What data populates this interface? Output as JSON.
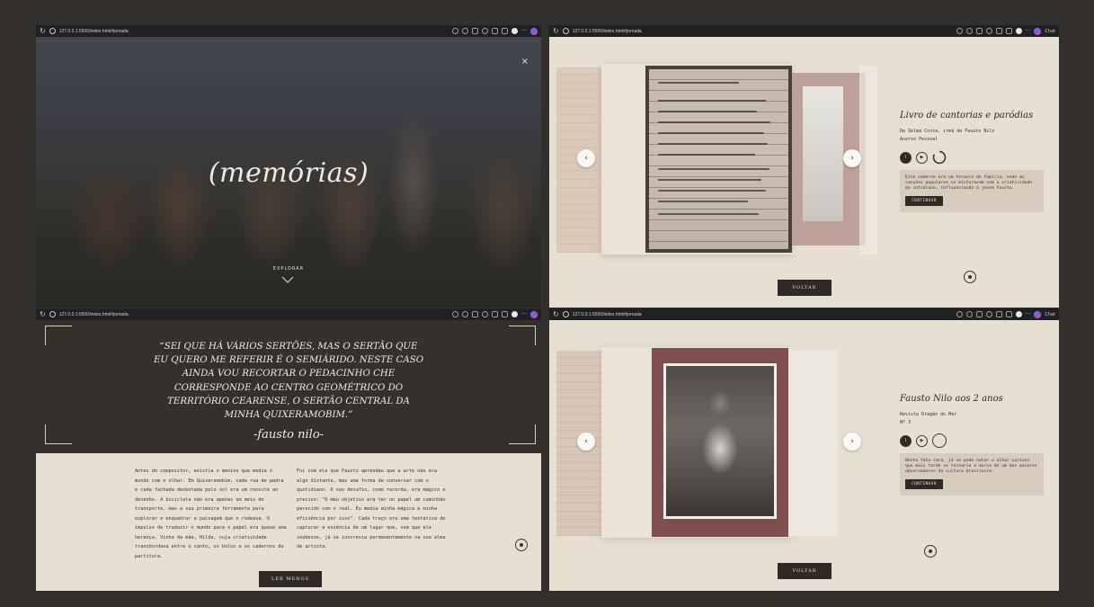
{
  "browser": {
    "url": "127.0.0.1:5500/index.html#jornada",
    "copilot_label": "Chat"
  },
  "hero": {
    "title": "(memórias)",
    "close": "×",
    "explore_label": "EXPLORAR"
  },
  "quote": {
    "text": "“SEI QUE HÁ VÁRIOS SERTÕES, MAS O SERTÃO QUE EU QUERO ME REFERIR É O SEMIÁRIDO. NESTE CASO AINDA VOU RECORTAR O PEDACINHO CHE CORRESPONDE AO CENTRO GEOMÉTRICO DO TERRITÓRIO CEARENSE, O SERTÃO CENTRAL DA MINHA QUIXERAMOBIM.”",
    "author": "-fausto nilo-"
  },
  "story": {
    "col_a": "Antes do compositor, existia o menino que media o mundo com o olhar. Em Quixeramobim, cada rua de pedra e cada fachada desbotada pelo sol era um convite ao desenho. A bicicleta não era apenas um meio de transporte, mas a sua primeira ferramenta para explorar e enquadrar a paisagem que o rodeava. O impulso de traduzir o mundo para o papel era quase uma herança. Vinha da mãe, Hilda, cuja criatividade transbordava entre o canto, os bolos e os cadernos de partitura.",
    "col_b": "Foi com ela que Fausto aprendeu que a arte não era algo distante, mas uma forma de conversar com o quotidiano. O seu desafio, como recorda, era mágico e preciso: \"O meu objetivo era ter no papel um caminhão parecido com o real. Eu media minha mágica e minha eficiência por isso\". Cada traço era uma tentativa de capturar a essência de um lugar que, sem que ele soubesse, já se inscrevia permanentemente na sua alma de artista.",
    "read_less": "LER MENOS"
  },
  "slide_notebook": {
    "title": "Livro de cantorias e paródias",
    "subtitle_1": "De Selma Costa, irmã de Fausto Nilo",
    "subtitle_2": "Acervo Pessoal",
    "description": "Este caderno era um tesouro de família, onde as canções populares se misturavam com a criatividade do cotidiano, influenciando o jovem Fausto.",
    "continue": "CONTINUAR",
    "back": "VOLTAR"
  },
  "slide_photo": {
    "title": "Fausto Nilo aos 2 anos",
    "subtitle_1": "Revista Dragão do Mar",
    "subtitle_2": "Nº 3",
    "description": "Nesta foto rara, já se pode notar o olhar curioso que mais tarde se tornaria a marca de um dos maiores observadores da cultura brasileira.",
    "continue": "CONTINUAR",
    "back": "VOLTAR"
  },
  "nav": {
    "prev": "‹",
    "next": "›"
  },
  "controls": {
    "info": "i",
    "play": "▶"
  },
  "icons": [
    "reload-icon",
    "info-icon",
    "chevron-down-icon",
    "close-icon",
    "play-icon",
    "chevron-left-icon",
    "chevron-right-icon"
  ]
}
